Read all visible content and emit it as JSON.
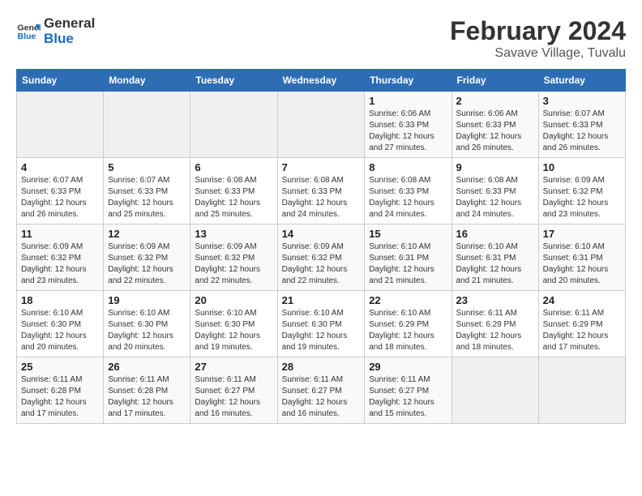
{
  "header": {
    "logo_general": "General",
    "logo_blue": "Blue",
    "title": "February 2024",
    "subtitle": "Savave Village, Tuvalu"
  },
  "weekdays": [
    "Sunday",
    "Monday",
    "Tuesday",
    "Wednesday",
    "Thursday",
    "Friday",
    "Saturday"
  ],
  "weeks": [
    [
      {
        "day": "",
        "empty": true
      },
      {
        "day": "",
        "empty": true
      },
      {
        "day": "",
        "empty": true
      },
      {
        "day": "",
        "empty": true
      },
      {
        "day": "1",
        "sunrise": "6:06 AM",
        "sunset": "6:33 PM",
        "daylight": "12 hours and 27 minutes."
      },
      {
        "day": "2",
        "sunrise": "6:06 AM",
        "sunset": "6:33 PM",
        "daylight": "12 hours and 26 minutes."
      },
      {
        "day": "3",
        "sunrise": "6:07 AM",
        "sunset": "6:33 PM",
        "daylight": "12 hours and 26 minutes."
      }
    ],
    [
      {
        "day": "4",
        "sunrise": "6:07 AM",
        "sunset": "6:33 PM",
        "daylight": "12 hours and 26 minutes."
      },
      {
        "day": "5",
        "sunrise": "6:07 AM",
        "sunset": "6:33 PM",
        "daylight": "12 hours and 25 minutes."
      },
      {
        "day": "6",
        "sunrise": "6:08 AM",
        "sunset": "6:33 PM",
        "daylight": "12 hours and 25 minutes."
      },
      {
        "day": "7",
        "sunrise": "6:08 AM",
        "sunset": "6:33 PM",
        "daylight": "12 hours and 24 minutes."
      },
      {
        "day": "8",
        "sunrise": "6:08 AM",
        "sunset": "6:33 PM",
        "daylight": "12 hours and 24 minutes."
      },
      {
        "day": "9",
        "sunrise": "6:08 AM",
        "sunset": "6:33 PM",
        "daylight": "12 hours and 24 minutes."
      },
      {
        "day": "10",
        "sunrise": "6:09 AM",
        "sunset": "6:32 PM",
        "daylight": "12 hours and 23 minutes."
      }
    ],
    [
      {
        "day": "11",
        "sunrise": "6:09 AM",
        "sunset": "6:32 PM",
        "daylight": "12 hours and 23 minutes."
      },
      {
        "day": "12",
        "sunrise": "6:09 AM",
        "sunset": "6:32 PM",
        "daylight": "12 hours and 22 minutes."
      },
      {
        "day": "13",
        "sunrise": "6:09 AM",
        "sunset": "6:32 PM",
        "daylight": "12 hours and 22 minutes."
      },
      {
        "day": "14",
        "sunrise": "6:09 AM",
        "sunset": "6:32 PM",
        "daylight": "12 hours and 22 minutes."
      },
      {
        "day": "15",
        "sunrise": "6:10 AM",
        "sunset": "6:31 PM",
        "daylight": "12 hours and 21 minutes."
      },
      {
        "day": "16",
        "sunrise": "6:10 AM",
        "sunset": "6:31 PM",
        "daylight": "12 hours and 21 minutes."
      },
      {
        "day": "17",
        "sunrise": "6:10 AM",
        "sunset": "6:31 PM",
        "daylight": "12 hours and 20 minutes."
      }
    ],
    [
      {
        "day": "18",
        "sunrise": "6:10 AM",
        "sunset": "6:30 PM",
        "daylight": "12 hours and 20 minutes."
      },
      {
        "day": "19",
        "sunrise": "6:10 AM",
        "sunset": "6:30 PM",
        "daylight": "12 hours and 20 minutes."
      },
      {
        "day": "20",
        "sunrise": "6:10 AM",
        "sunset": "6:30 PM",
        "daylight": "12 hours and 19 minutes."
      },
      {
        "day": "21",
        "sunrise": "6:10 AM",
        "sunset": "6:30 PM",
        "daylight": "12 hours and 19 minutes."
      },
      {
        "day": "22",
        "sunrise": "6:10 AM",
        "sunset": "6:29 PM",
        "daylight": "12 hours and 18 minutes."
      },
      {
        "day": "23",
        "sunrise": "6:11 AM",
        "sunset": "6:29 PM",
        "daylight": "12 hours and 18 minutes."
      },
      {
        "day": "24",
        "sunrise": "6:11 AM",
        "sunset": "6:29 PM",
        "daylight": "12 hours and 17 minutes."
      }
    ],
    [
      {
        "day": "25",
        "sunrise": "6:11 AM",
        "sunset": "6:28 PM",
        "daylight": "12 hours and 17 minutes."
      },
      {
        "day": "26",
        "sunrise": "6:11 AM",
        "sunset": "6:28 PM",
        "daylight": "12 hours and 17 minutes."
      },
      {
        "day": "27",
        "sunrise": "6:11 AM",
        "sunset": "6:27 PM",
        "daylight": "12 hours and 16 minutes."
      },
      {
        "day": "28",
        "sunrise": "6:11 AM",
        "sunset": "6:27 PM",
        "daylight": "12 hours and 16 minutes."
      },
      {
        "day": "29",
        "sunrise": "6:11 AM",
        "sunset": "6:27 PM",
        "daylight": "12 hours and 15 minutes."
      },
      {
        "day": "",
        "empty": true
      },
      {
        "day": "",
        "empty": true
      }
    ]
  ]
}
